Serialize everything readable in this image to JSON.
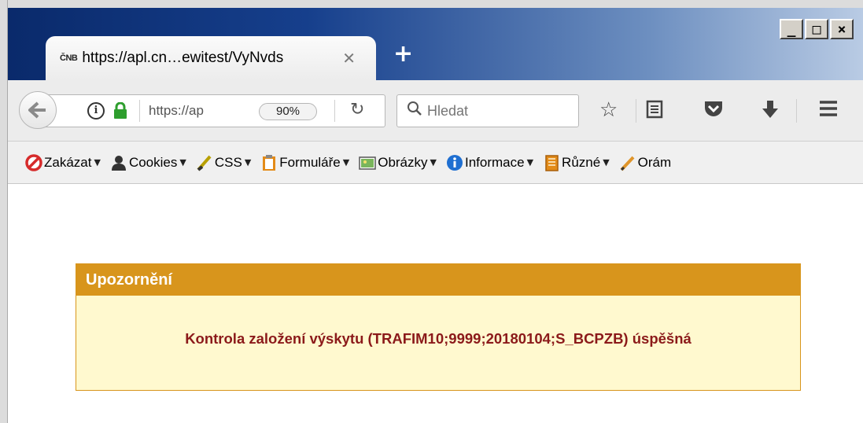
{
  "window": {
    "controls": {
      "minimize": "_",
      "maximize": "□",
      "close": "×"
    }
  },
  "tab": {
    "favicon_text": "ČNB",
    "title": "https://apl.cn…ewitest/VyNvds",
    "close": "✕",
    "new_tab": "+"
  },
  "nav": {
    "url": "https://ap",
    "zoom": "90%",
    "search_placeholder": "Hledat"
  },
  "toolbar": {
    "items": [
      {
        "label": "Zakázat",
        "icon": "disable-icon"
      },
      {
        "label": "Cookies",
        "icon": "cookies-icon"
      },
      {
        "label": "CSS",
        "icon": "css-icon"
      },
      {
        "label": "Formuláře",
        "icon": "forms-icon"
      },
      {
        "label": "Obrázky",
        "icon": "images-icon"
      },
      {
        "label": "Informace",
        "icon": "information-icon"
      },
      {
        "label": "Různé",
        "icon": "misc-icon"
      },
      {
        "label": "Orám",
        "icon": "outline-icon"
      }
    ]
  },
  "alert": {
    "title": "Upozornění",
    "message": "Kontrola založení výskytu (TRAFIM10;9999;20180104;S_BCPZB) úspěšná"
  },
  "colors": {
    "alert_header": "#d8951c",
    "alert_background": "#fff9cf",
    "alert_text": "#8b1a1a"
  }
}
